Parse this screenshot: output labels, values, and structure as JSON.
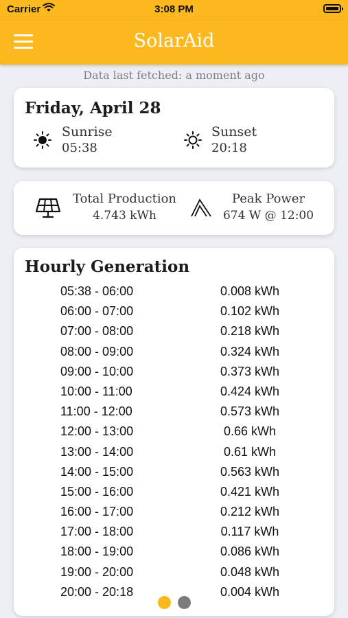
{
  "status_bar": {
    "carrier": "Carrier",
    "time": "3:08 PM"
  },
  "app_bar": {
    "title": "SolarAid"
  },
  "fetched_text": "Data last fetched: a moment ago",
  "day_card": {
    "date": "Friday, April 28",
    "sunrise_label": "Sunrise",
    "sunrise_time": "05:38",
    "sunset_label": "Sunset",
    "sunset_time": "20:18"
  },
  "stats_card": {
    "production_label": "Total Production",
    "production_value": "4.743 kWh",
    "peak_label": "Peak Power",
    "peak_value": "674 W @ 12:00"
  },
  "hourly": {
    "title": "Hourly Generation",
    "rows": [
      {
        "range": "05:38 - 06:00",
        "value": "0.008 kWh"
      },
      {
        "range": "06:00 - 07:00",
        "value": "0.102 kWh"
      },
      {
        "range": "07:00 - 08:00",
        "value": "0.218 kWh"
      },
      {
        "range": "08:00 - 09:00",
        "value": "0.324 kWh"
      },
      {
        "range": "09:00 - 10:00",
        "value": "0.373 kWh"
      },
      {
        "range": "10:00 - 11:00",
        "value": "0.424 kWh"
      },
      {
        "range": "11:00 - 12:00",
        "value": "0.573 kWh"
      },
      {
        "range": "12:00 - 13:00",
        "value": "0.66 kWh"
      },
      {
        "range": "13:00 - 14:00",
        "value": "0.61 kWh"
      },
      {
        "range": "14:00 - 15:00",
        "value": "0.563 kWh"
      },
      {
        "range": "15:00 - 16:00",
        "value": "0.421 kWh"
      },
      {
        "range": "16:00 - 17:00",
        "value": "0.212 kWh"
      },
      {
        "range": "17:00 - 18:00",
        "value": "0.117 kWh"
      },
      {
        "range": "18:00 - 19:00",
        "value": "0.086 kWh"
      },
      {
        "range": "19:00 - 20:00",
        "value": "0.048 kWh"
      },
      {
        "range": "20:00 - 20:18",
        "value": "0.004 kWh"
      }
    ]
  },
  "pagination": {
    "total": 2,
    "active_index": 0
  },
  "colors": {
    "accent": "#fbb81f",
    "background": "#eceff3",
    "dot_inactive": "#7c7c7c"
  },
  "icons": [
    "menu-icon",
    "wifi-icon",
    "battery-icon",
    "sunrise-icon",
    "sunset-icon",
    "solar-panel-icon",
    "peak-icon"
  ]
}
